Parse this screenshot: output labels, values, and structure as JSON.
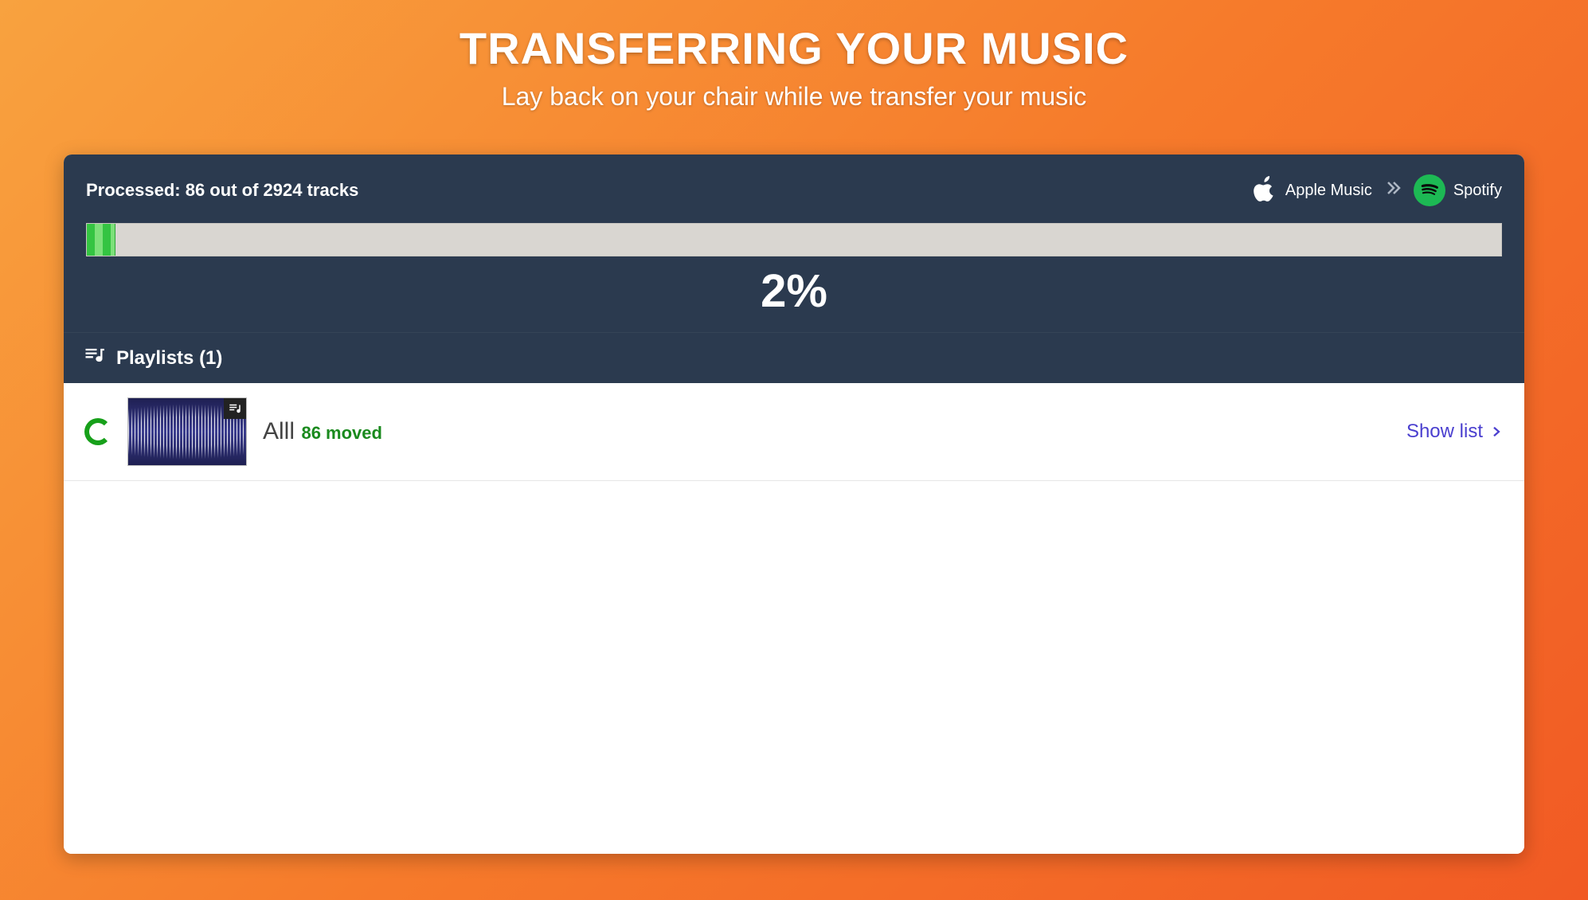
{
  "hero": {
    "title": "TRANSFERRING YOUR MUSIC",
    "subtitle": "Lay back on your chair while we transfer your music"
  },
  "progress": {
    "processed_label": "Processed: 86 out of 2924 tracks",
    "percent_label": "2%",
    "percent_value": 2,
    "source_service": "Apple Music",
    "target_service": "Spotify"
  },
  "playlists_section": {
    "heading": "Playlists (1)"
  },
  "playlists": [
    {
      "name": "Alll",
      "moved_label": "86 moved",
      "action_label": "Show list"
    }
  ]
}
